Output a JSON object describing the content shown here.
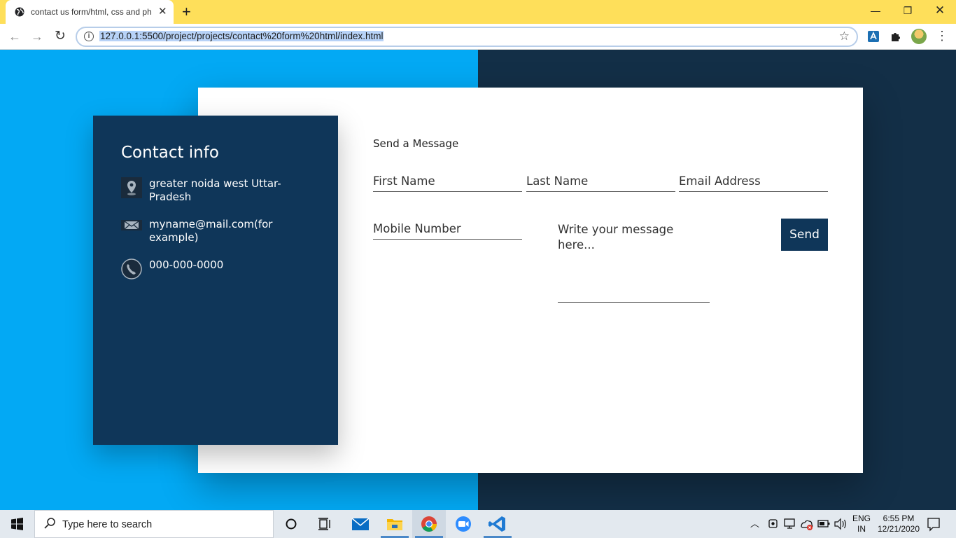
{
  "browser": {
    "tab": {
      "title": "contact us form/html, css and ph"
    },
    "url": "127.0.0.1:5500/project/projects/contact%20form%20html/index.html"
  },
  "contact_info": {
    "title": "Contact info",
    "address": "greater noida west Uttar-Pradesh",
    "email": "myname@mail.com(for example)",
    "phone": "000-000-0000"
  },
  "form": {
    "title": "Send a Message",
    "first_name": "First Name",
    "last_name": "Last Name",
    "email": "Email Address",
    "mobile": "Mobile Number",
    "message": "Write your message here...",
    "send": "Send"
  },
  "taskbar": {
    "search": "Type here to search",
    "lang": "ENG",
    "region": "IN",
    "time": "6:55 PM",
    "date": "12/21/2020"
  },
  "colors": {
    "left_bg": "#03a9f4",
    "right_bg": "#132f47",
    "card_navy": "#0f3659",
    "tabstrip": "#fedf5a"
  }
}
